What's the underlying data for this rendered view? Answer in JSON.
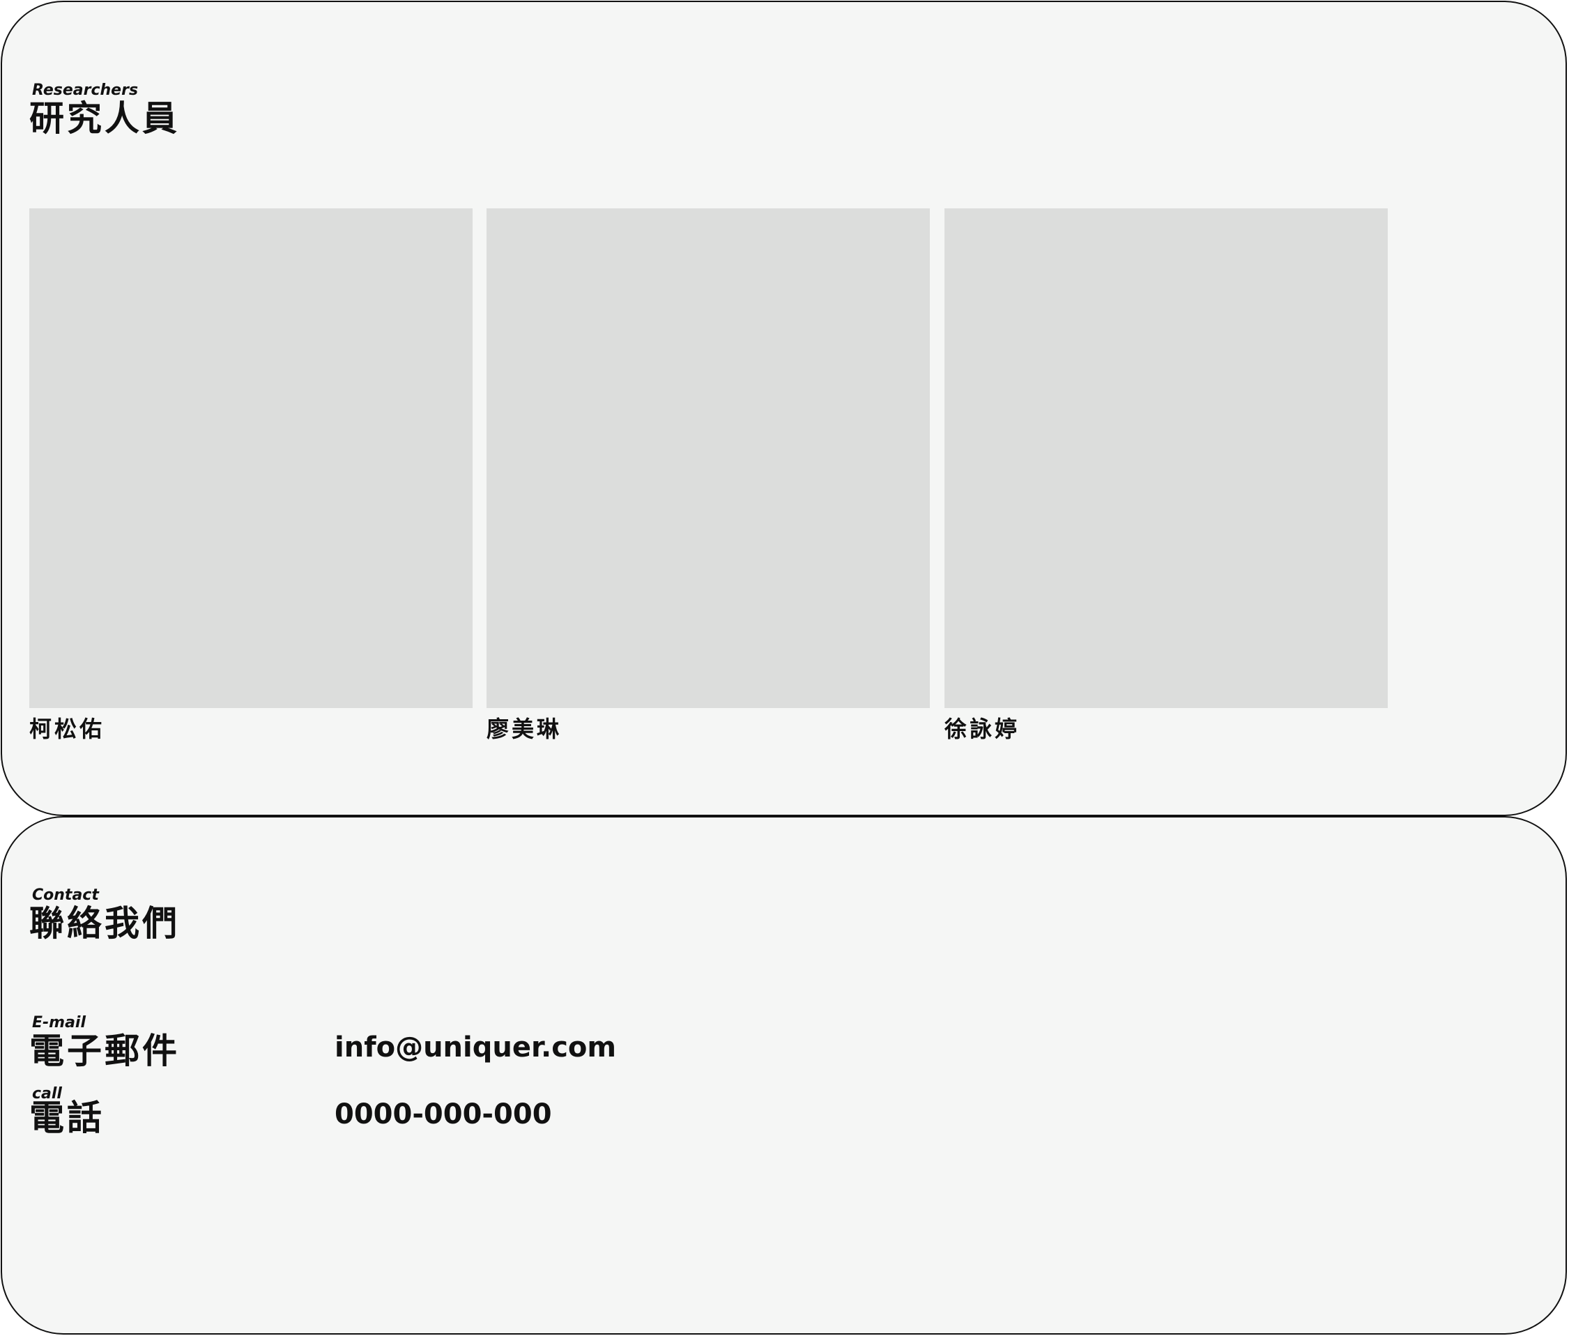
{
  "researchers": {
    "kicker": "Researchers",
    "title": "研究人員",
    "people": [
      {
        "name": "柯松佑"
      },
      {
        "name": "廖美琳"
      },
      {
        "name": "徐詠婷"
      }
    ],
    "photo_color": "#dcdddc"
  },
  "contact": {
    "kicker": "Contact",
    "title": "聯絡我們",
    "email": {
      "kicker": "E-mail",
      "label": "電子郵件",
      "value": "info@uniquer.com"
    },
    "phone": {
      "kicker": "call",
      "label": "電話",
      "value": "0000-000-000"
    }
  },
  "colors": {
    "panel_background": "#f5f6f5",
    "panel_border": "#111111",
    "text": "#111111"
  }
}
